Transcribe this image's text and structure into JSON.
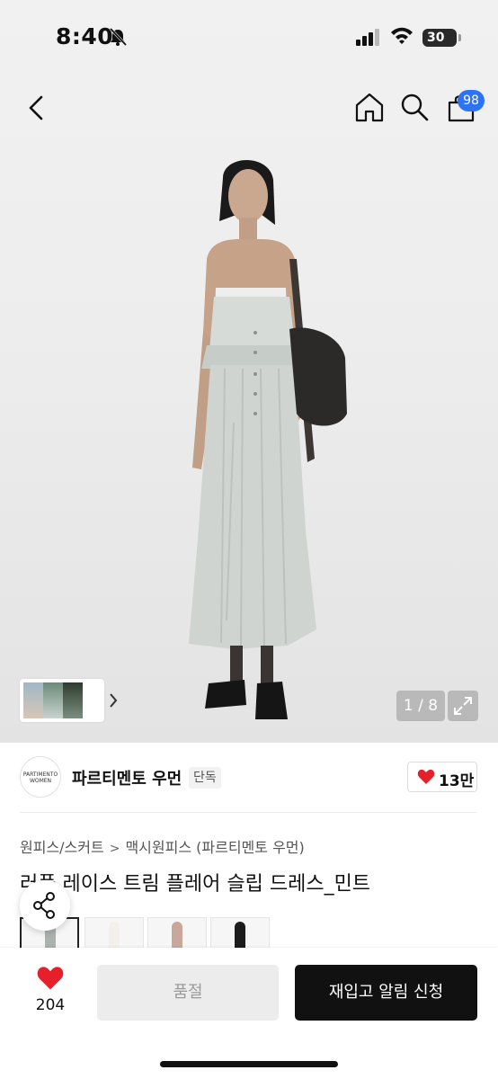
{
  "status_bar": {
    "time": "8:40",
    "battery": "30"
  },
  "nav": {
    "cart_count": "98"
  },
  "gallery": {
    "pager": "1 / 8"
  },
  "brand": {
    "logo_line1": "PARTIMENTO",
    "logo_line2": "WOMEN",
    "name": "파르티멘토 우먼",
    "tag": "단독",
    "like_count": "13만"
  },
  "breadcrumb": {
    "category": "원피스/스커트",
    "separator": ">",
    "subcategory": "맥시원피스 (파르티멘토 우먼)"
  },
  "product": {
    "title": "러플 레이스 트림 플레어 슬립 드레스_민트"
  },
  "options": [
    {
      "color": "#aab3ae"
    },
    {
      "color": "#f2f0ea"
    },
    {
      "color": "#c8a89a"
    },
    {
      "color": "#1c1c1c"
    }
  ],
  "bottom_bar": {
    "wish_count": "204",
    "soldout_label": "품절",
    "restock_label": "재입고 알림 신청"
  },
  "colors": {
    "accent_blue": "#2d73f5",
    "heart_red": "#e5202a",
    "dress": "#cfd4d0"
  }
}
